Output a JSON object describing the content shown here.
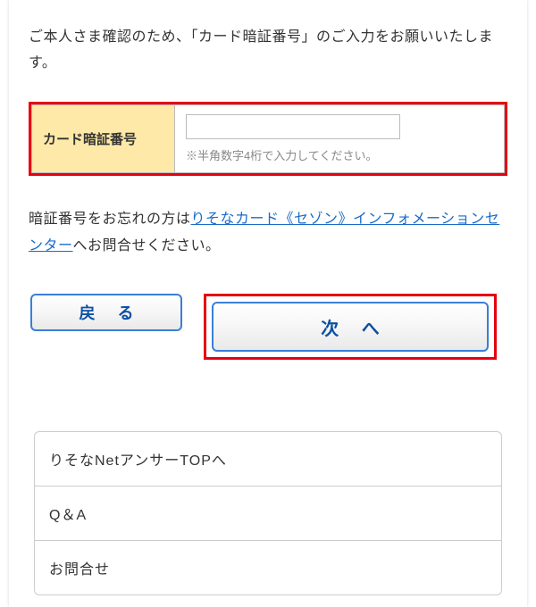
{
  "instruction": "ご本人さま確認のため、「カード暗証番号」のご入力をお願いいたします。",
  "form": {
    "label": "カード暗証番号",
    "value": "",
    "note": "※半角数字4桁で入力してください。"
  },
  "forgot": {
    "prefix": "暗証番号をお忘れの方は",
    "link": "りそなカード《セゾン》インフォメーションセンター",
    "suffix": "へお問合せください。"
  },
  "buttons": {
    "back": "戻 る",
    "next": "次 へ"
  },
  "links": {
    "items": [
      "りそなNetアンサーTOPへ",
      "Q＆A",
      "お問合せ"
    ]
  }
}
